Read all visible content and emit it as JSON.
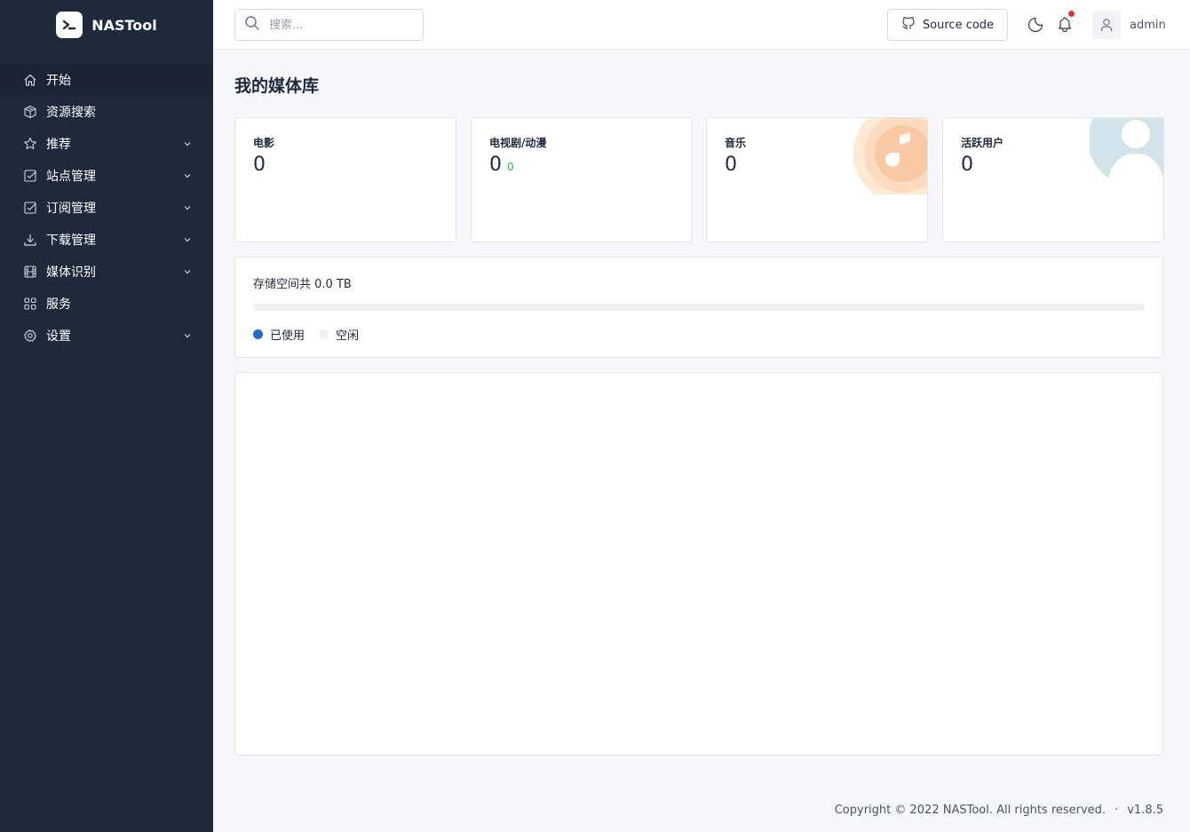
{
  "brand": {
    "name": "NASTool"
  },
  "sidebar": {
    "items": [
      {
        "label": "开始",
        "icon": "home-icon",
        "active": true,
        "expandable": false
      },
      {
        "label": "资源搜索",
        "icon": "box-icon",
        "expandable": false
      },
      {
        "label": "推荐",
        "icon": "star-icon",
        "expandable": true
      },
      {
        "label": "站点管理",
        "icon": "checkbox-icon",
        "expandable": true
      },
      {
        "label": "订阅管理",
        "icon": "checkbox-icon",
        "expandable": true
      },
      {
        "label": "下载管理",
        "icon": "download-icon",
        "expandable": true
      },
      {
        "label": "媒体识别",
        "icon": "film-icon",
        "expandable": true
      },
      {
        "label": "服务",
        "icon": "apps-icon",
        "expandable": false
      },
      {
        "label": "设置",
        "icon": "settings-icon",
        "expandable": true
      }
    ]
  },
  "header": {
    "search_placeholder": "搜索...",
    "source_label": "Source code",
    "username": "admin",
    "has_notification": true
  },
  "main": {
    "title": "我的媒体库",
    "stats": [
      {
        "label": "电影",
        "value": "0",
        "sub": ""
      },
      {
        "label": "电视剧/动漫",
        "value": "0",
        "sub": "0"
      },
      {
        "label": "音乐",
        "value": "0",
        "sub": ""
      },
      {
        "label": "活跃用户",
        "value": "0",
        "sub": ""
      }
    ],
    "storage": {
      "title_prefix": "存储空间共",
      "total": "0.0 TB",
      "used_fraction": 0,
      "legend_used": "已使用",
      "legend_free": "空闲"
    }
  },
  "colors": {
    "sidebar_bg": "#1e293b",
    "used": "#206bc4",
    "free": "#eef0f3",
    "accent_green": "#2fb344"
  },
  "footer": {
    "copyright": "Copyright © 2022 NASTool. All rights reserved.",
    "separator": "·",
    "version": "v1.8.5"
  }
}
